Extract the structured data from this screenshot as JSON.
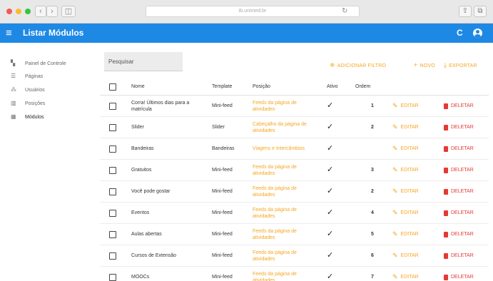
{
  "browser": {
    "nav_back": "‹",
    "nav_forward": "›",
    "sidebar_toggle": "◫",
    "url": "ib.unimed.br",
    "reload": "↻",
    "share": "⇧",
    "tabs": "⧉"
  },
  "header": {
    "title": "Listar Módulos",
    "menu_icon": "≡",
    "refresh_icon": "C"
  },
  "sidebar": {
    "items": [
      {
        "label": "Painel de Controle",
        "icon": "dashboard-icon",
        "glyph": "▚"
      },
      {
        "label": "Páginas",
        "icon": "pages-icon",
        "glyph": "☰"
      },
      {
        "label": "Usuários",
        "icon": "users-icon",
        "glyph": "⁂"
      },
      {
        "label": "Posições",
        "icon": "positions-icon",
        "glyph": "▥"
      },
      {
        "label": "Módulos",
        "icon": "modules-icon",
        "glyph": "▦"
      }
    ]
  },
  "toolbar": {
    "search_placeholder": "Pesquisar",
    "filter_label": "ADICIONAR FILTRO",
    "filter_glyph": "≑",
    "new_label": "NOVO",
    "new_glyph": "+",
    "export_label": "EXPORTAR",
    "export_glyph": "⤓"
  },
  "table": {
    "columns": {
      "name": "Nome",
      "template": "Template",
      "position": "Posição",
      "active": "Ativo",
      "order": "Ordem"
    },
    "edit_label": "EDITAR",
    "edit_glyph": "✎",
    "delete_label": "DELETAR",
    "check_glyph": "✓",
    "rows": [
      {
        "name": "Corra! Últimos dias para a matrícula",
        "template": "Mini-feed",
        "position": "Feeds da página de atividades",
        "order": "1"
      },
      {
        "name": "Slider",
        "template": "Slider",
        "position": "Cabeçalho da página de atividades",
        "order": "2"
      },
      {
        "name": "Bandeiras",
        "template": "Bandeiras",
        "position": "Viagens e Intercâmbios",
        "order": ""
      },
      {
        "name": "Gratuitos",
        "template": "Mini-feed",
        "position": "Feeds da página de atividades",
        "order": "3"
      },
      {
        "name": "Você pode gostar",
        "template": "Mini-feed",
        "position": "Feeds da página de atividades",
        "order": "2"
      },
      {
        "name": "Eventos",
        "template": "Mini-feed",
        "position": "Feeds da página de atividades",
        "order": "4"
      },
      {
        "name": "Aulas abertas",
        "template": "Mini-feed",
        "position": "Feeds da página de atividades",
        "order": "5"
      },
      {
        "name": "Cursos de Extensão",
        "template": "Mini-feed",
        "position": "Feeds da página de atividades",
        "order": "6"
      },
      {
        "name": "MOOCs",
        "template": "Mini-feed",
        "position": "Feeds da página de atividades",
        "order": "7"
      }
    ]
  },
  "colors": {
    "header_bg": "#1e88e5",
    "accent": "#f5a623",
    "danger": "#e53935"
  }
}
